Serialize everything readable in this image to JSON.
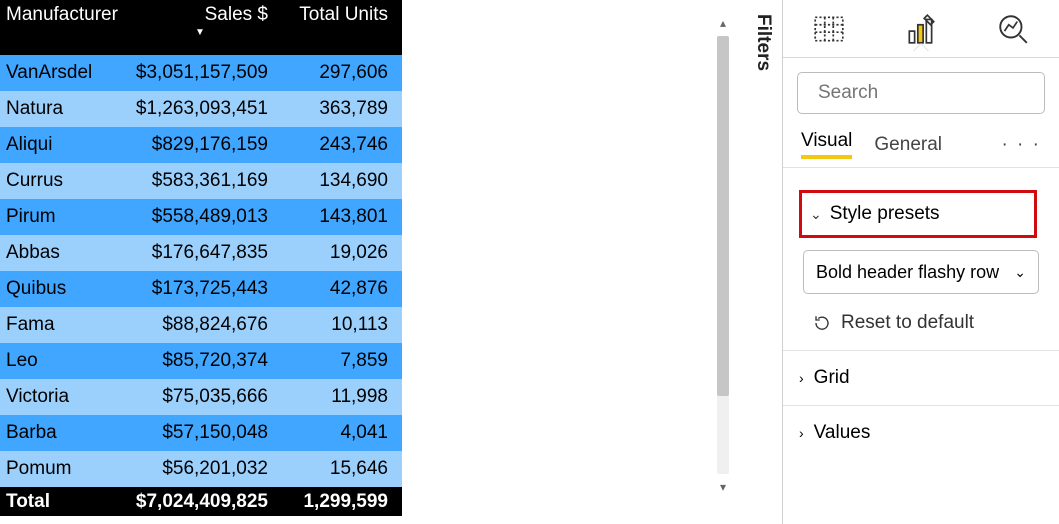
{
  "table": {
    "columns": {
      "manufacturer": "Manufacturer",
      "sales": "Sales $",
      "units": "Total Units"
    },
    "sort_indicator": "▼",
    "rows": [
      {
        "manu": "VanArsdel",
        "sales": "$3,051,157,509",
        "units": "297,606"
      },
      {
        "manu": "Natura",
        "sales": "$1,263,093,451",
        "units": "363,789"
      },
      {
        "manu": "Aliqui",
        "sales": "$829,176,159",
        "units": "243,746"
      },
      {
        "manu": "Currus",
        "sales": "$583,361,169",
        "units": "134,690"
      },
      {
        "manu": "Pirum",
        "sales": "$558,489,013",
        "units": "143,801"
      },
      {
        "manu": "Abbas",
        "sales": "$176,647,835",
        "units": "19,026"
      },
      {
        "manu": "Quibus",
        "sales": "$173,725,443",
        "units": "42,876"
      },
      {
        "manu": "Fama",
        "sales": "$88,824,676",
        "units": "10,113"
      },
      {
        "manu": "Leo",
        "sales": "$85,720,374",
        "units": "7,859"
      },
      {
        "manu": "Victoria",
        "sales": "$75,035,666",
        "units": "11,998"
      },
      {
        "manu": "Barba",
        "sales": "$57,150,048",
        "units": "4,041"
      },
      {
        "manu": "Pomum",
        "sales": "$56,201,032",
        "units": "15,646"
      }
    ],
    "total": {
      "label": "Total",
      "sales": "$7,024,409,825",
      "units": "1,299,599"
    }
  },
  "filters": {
    "label": "Filters"
  },
  "pane": {
    "search_placeholder": "Search",
    "subtabs": {
      "visual": "Visual",
      "general": "General",
      "more": "· · ·"
    },
    "style_presets": {
      "label": "Style presets",
      "selected": "Bold header flashy row",
      "reset": "Reset to default"
    },
    "grid": {
      "label": "Grid"
    },
    "values": {
      "label": "Values"
    }
  }
}
